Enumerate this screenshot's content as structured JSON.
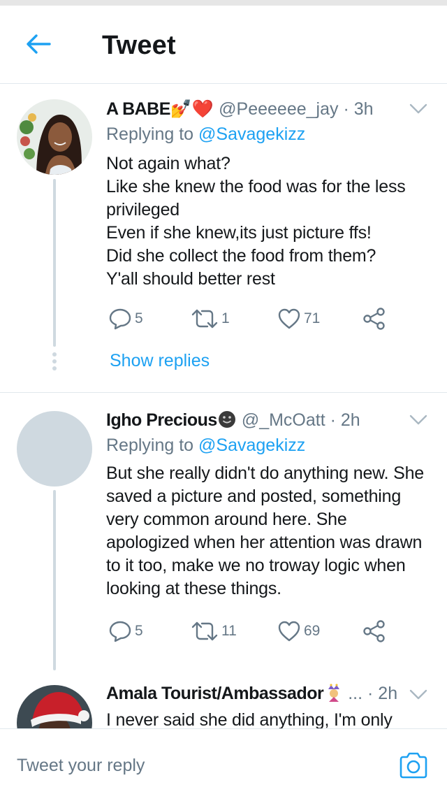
{
  "header": {
    "title": "Tweet"
  },
  "tweets": [
    {
      "name": "A BABE💅❤️",
      "handle": "@Peeeeee_jay",
      "time": "· 3h",
      "replying_prefix": "Replying to",
      "replying_to": "@Savagekizz",
      "lines": [
        "Not again what?",
        "Like she knew the food  was for the less",
        "privileged",
        "Even if she knew,its just picture ffs!",
        "Did she collect the food from them?",
        "Y'all should better rest"
      ],
      "replies": "5",
      "retweets": "1",
      "likes": "71",
      "show_replies": "Show replies"
    },
    {
      "name": "Igho Precious",
      "handle": "@_McOatt",
      "time": "· 2h",
      "replying_prefix": "Replying to",
      "replying_to": "@Savagekizz",
      "lines": [
        "But she really didn't do anything new. She",
        "saved a picture and posted, something",
        "very common around here. She",
        "apologized when her attention was drawn",
        "to it too, make we no troway logic when",
        "looking at these things."
      ],
      "replies": "5",
      "retweets": "11",
      "likes": "69"
    },
    {
      "name": "Amala Tourist/Ambassador",
      "handle": "...",
      "time": "· 2h",
      "lines": [
        "I never said she did anything, I'm only"
      ]
    }
  ],
  "composer": {
    "placeholder": "Tweet your reply"
  },
  "colors": {
    "accent": "#1da1f2",
    "muted": "#657786",
    "divider": "#e1e8ed",
    "text": "#14171a"
  },
  "icons": [
    "back-arrow-icon",
    "chevron-down-icon",
    "reply-icon",
    "retweet-icon",
    "heart-icon",
    "share-icon",
    "camera-icon"
  ]
}
